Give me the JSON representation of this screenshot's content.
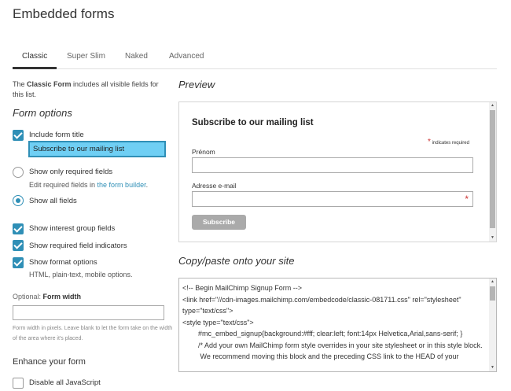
{
  "page_title": "Embedded forms",
  "tabs": [
    "Classic",
    "Super Slim",
    "Naked",
    "Advanced"
  ],
  "intro": {
    "prefix": "The ",
    "bold": "Classic Form",
    "suffix": " includes all visible fields for this list."
  },
  "form_options": {
    "heading": "Form options",
    "include_title_label": "Include form title",
    "title_value": "Subscribe to our mailing list",
    "only_required_label": "Show only required fields",
    "edit_required_prefix": "Edit required fields in ",
    "edit_required_link": "the form builder",
    "edit_required_suffix": ".",
    "all_fields_label": "Show all fields",
    "interest_groups_label": "Show interest group fields",
    "required_indicators_label": "Show required field indicators",
    "format_options_label": "Show format options",
    "format_options_sub": "HTML, plain-text, mobile options.",
    "width_optional": "Optional: ",
    "width_label": "Form width",
    "width_help": "Form width in pixels. Leave blank to let the form take on the width of the area where it's placed."
  },
  "enhance": {
    "heading": "Enhance your form",
    "disable_js_label": "Disable all JavaScript"
  },
  "preview": {
    "heading": "Preview",
    "form_title": "Subscribe to our mailing list",
    "required_note": "indicates required",
    "required_star": "*",
    "field1_label": "Prénom",
    "field2_label": "Adresse e-mail",
    "button_label": "Subscribe"
  },
  "copy": {
    "heading": "Copy/paste onto your site",
    "lines": [
      "<!-- Begin MailChimp Signup Form -->",
      "<link href=\"//cdn-images.mailchimp.com/embedcode/classic-081711.css\" rel=\"stylesheet\" type=\"text/css\">",
      "<style type=\"text/css\">",
      "        #mc_embed_signup{background:#fff; clear:left; font:14px Helvetica,Arial,sans-serif; }",
      "        /* Add your own MailChimp form style overrides in your site stylesheet or in this style block.",
      "         We recommend moving this block and the preceding CSS link to the HEAD of your"
    ]
  },
  "colors": {
    "accent": "#2f8fb6",
    "title_highlight": "#6fcff4",
    "required": "#cc3333"
  }
}
